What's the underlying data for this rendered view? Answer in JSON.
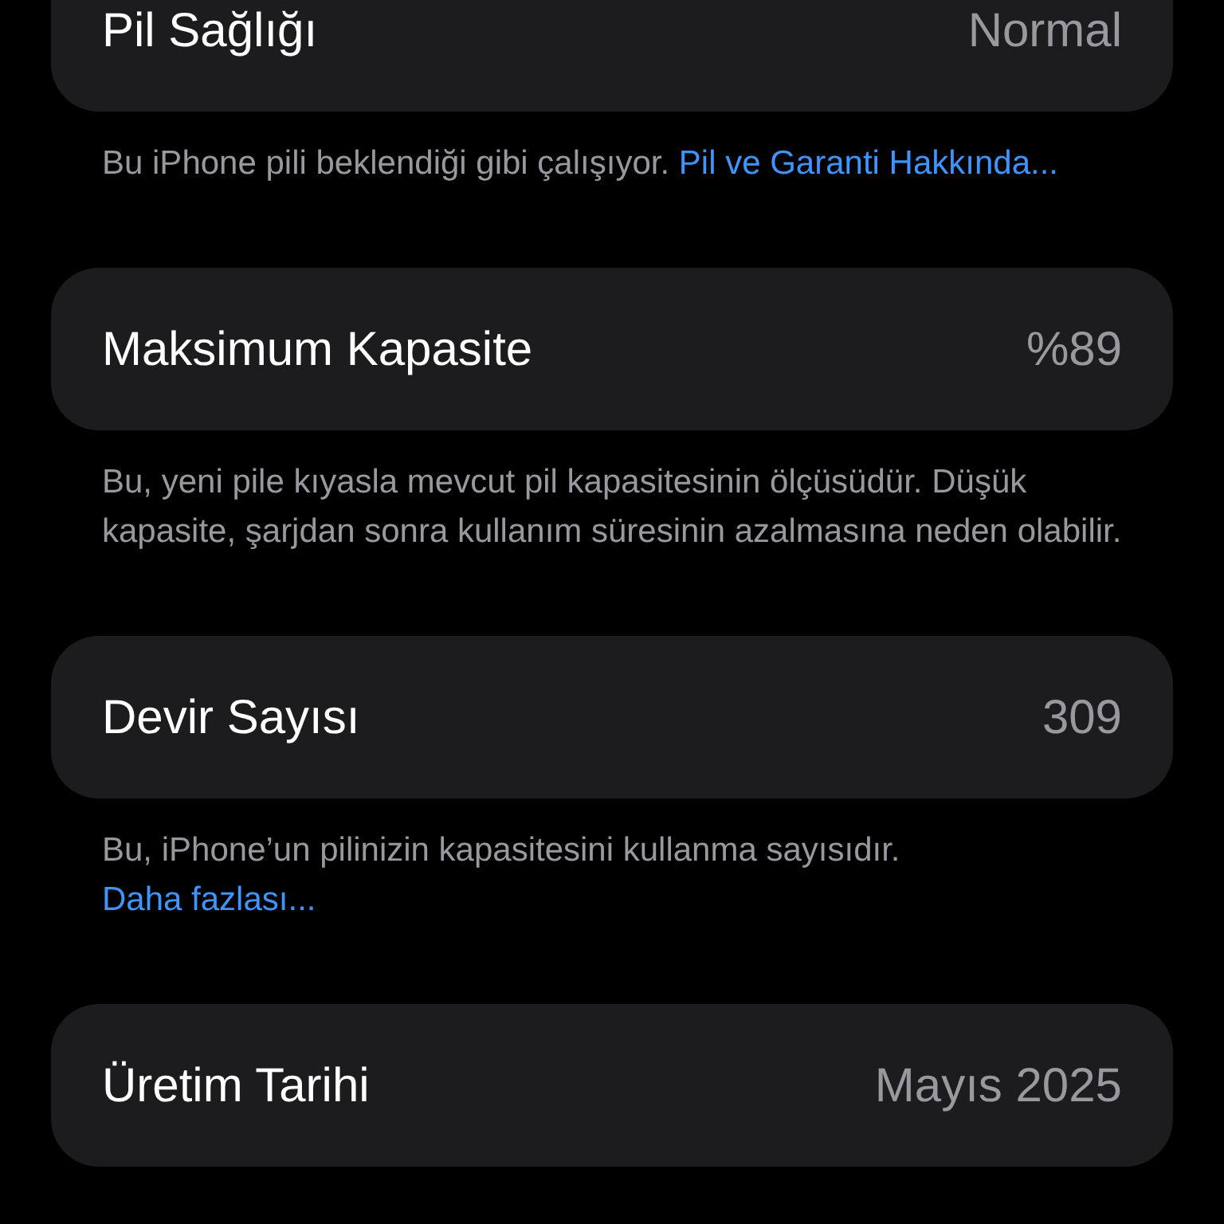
{
  "sections": [
    {
      "label": "Pil Sağlığı",
      "value": "Normal",
      "note": {
        "text": "Bu iPhone pili beklendiği gibi çalışıyor.",
        "link": "Pil ve Garanti Hakkında..."
      }
    },
    {
      "label": "Maksimum Kapasite",
      "value": "%89",
      "note": {
        "text": "Bu, yeni pile kıyasla mevcut pil kapasitesinin ölçüsüdür. Düşük kapasite, şarjdan sonra kullanım süresinin azalmasına neden olabilir."
      }
    },
    {
      "label": "Devir Sayısı",
      "value": "309",
      "note": {
        "text": "Bu, iPhone’un pilinizin kapasitesini kullanma sayısıdır.",
        "link": "Daha fazlası..."
      }
    },
    {
      "label": "Üretim Tarihi",
      "value": "Mayıs 2025"
    }
  ]
}
